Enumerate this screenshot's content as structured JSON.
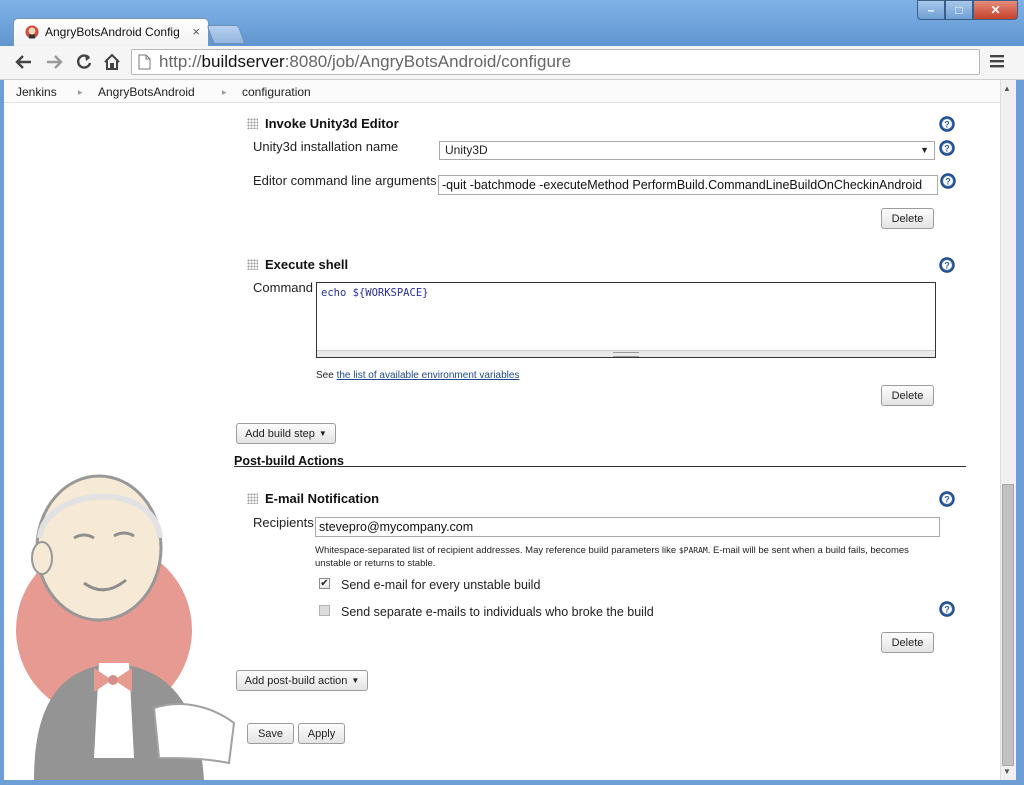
{
  "window": {
    "tab_title": "AngryBotsAndroid Config",
    "tab_close": "×",
    "minimize": "–",
    "maximize": "□",
    "close": "✕"
  },
  "toolbar": {
    "url_prefix": "http://",
    "url_host": "buildserver",
    "url_rest": ":8080/job/AngryBotsAndroid/configure"
  },
  "breadcrumb": [
    "Jenkins",
    "AngryBotsAndroid",
    "configuration"
  ],
  "unity_step": {
    "title": "Invoke Unity3d Editor",
    "installation_label": "Unity3d installation name",
    "installation_value": "Unity3D",
    "args_label": "Editor command line arguments",
    "args_value": "-quit -batchmode -executeMethod PerformBuild.CommandLineBuildOnCheckinAndroid",
    "delete_label": "Delete"
  },
  "shell_step": {
    "title": "Execute shell",
    "command_label": "Command",
    "command_value": "echo ${WORKSPACE}",
    "see_text": "See",
    "env_link": "the list of available environment variables",
    "delete_label": "Delete"
  },
  "add_build_step": "Add build step",
  "post_build": {
    "heading": "Post-build Actions"
  },
  "email": {
    "title": "E-mail Notification",
    "recipients_label": "Recipients",
    "recipients_value": "stevepro@mycompany.com",
    "description_1": "Whitespace-separated list of recipient addresses. May reference build parameters like",
    "description_param": "$PARAM",
    "description_2": ". E-mail will be sent when a build fails, becomes unstable or returns to stable.",
    "unstable_label": "Send e-mail for every unstable build",
    "unstable_checked": true,
    "individuals_label": "Send separate e-mails to individuals who broke the build",
    "individuals_checked": false,
    "delete_label": "Delete"
  },
  "add_post_build": "Add post-build action",
  "save_label": "Save",
  "apply_label": "Apply",
  "colors": {
    "link": "#204a87",
    "help_icon": "#2b5fa8",
    "command_text": "#2a2f9c",
    "butler_circle": "#d24939"
  }
}
